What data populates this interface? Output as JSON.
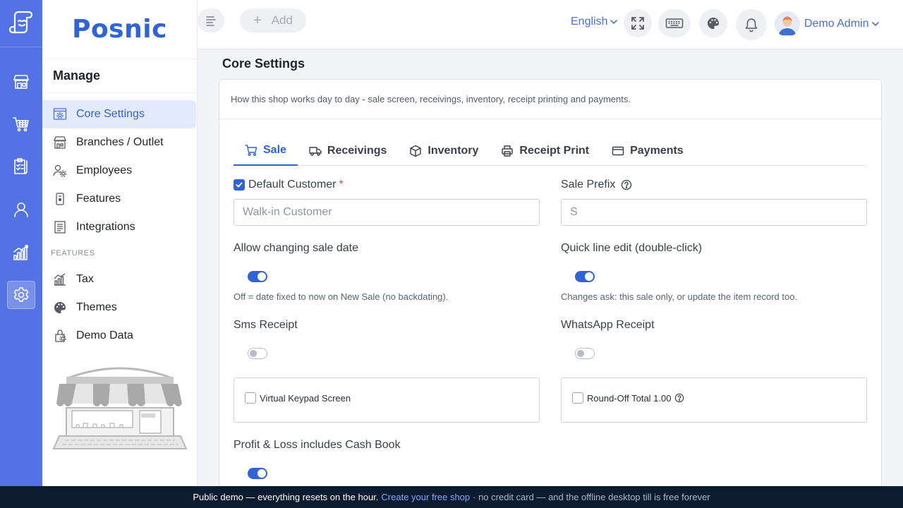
{
  "colors": {
    "accent": "#2f63d6",
    "rail": "#5272e6",
    "banner": "#0d1b30",
    "link": "#7ea7ff",
    "required": "#e0474c"
  },
  "rail": {
    "items": [
      {
        "icon": "store-icon"
      },
      {
        "icon": "cart-icon"
      },
      {
        "icon": "clipboard-icon"
      },
      {
        "icon": "user-icon"
      },
      {
        "icon": "chart-icon"
      },
      {
        "icon": "gear-icon",
        "active": true
      }
    ]
  },
  "sidebar": {
    "brand": "Posnic",
    "title": "Manage",
    "items": [
      {
        "label": "Core Settings",
        "icon": "settings-window-icon"
      },
      {
        "label": "Branches / Outlet",
        "icon": "building-icon"
      },
      {
        "label": "Employees",
        "icon": "employees-icon"
      },
      {
        "label": "Features",
        "icon": "features-icon"
      },
      {
        "label": "Integrations",
        "icon": "integrations-icon"
      }
    ],
    "section_label": "FEATURES",
    "feature_items": [
      {
        "label": "Tax",
        "icon": "tax-icon"
      },
      {
        "label": "Themes",
        "icon": "palette-icon"
      },
      {
        "label": "Demo Data",
        "icon": "demo-data-icon"
      }
    ]
  },
  "topbar": {
    "add_label": "Add",
    "language": "English",
    "user_name": "Demo Admin"
  },
  "page": {
    "title": "Core Settings",
    "description": "How this shop works day to day - sale screen, receivings, inventory, receipt printing and payments."
  },
  "tabs": [
    {
      "label": "Sale",
      "icon": "cart-icon",
      "active": true
    },
    {
      "label": "Receivings",
      "icon": "truck-icon"
    },
    {
      "label": "Inventory",
      "icon": "box-icon"
    },
    {
      "label": "Receipt Print",
      "icon": "printer-icon"
    },
    {
      "label": "Payments",
      "icon": "card-icon"
    }
  ],
  "sale": {
    "default_customer": {
      "label": "Default Customer",
      "required_mark": "*",
      "checked": true,
      "placeholder": "Walk-in Customer"
    },
    "sale_prefix": {
      "label": "Sale Prefix",
      "value": "S"
    },
    "allow_changing_sale_date": {
      "label": "Allow changing sale date",
      "on": true,
      "hint": "Off = date fixed to now on New Sale (no backdating)."
    },
    "quick_line_edit": {
      "label": "Quick line edit (double-click)",
      "on": true,
      "hint": "Changes ask: this sale only, or update the item record too."
    },
    "sms_receipt": {
      "label": "Sms Receipt",
      "on": false
    },
    "whatsapp_receipt": {
      "label": "WhatsApp Receipt",
      "on": false
    },
    "virtual_keypad": {
      "label": "Virtual Keypad Screen",
      "checked": false
    },
    "round_off_total": {
      "label": "Round-Off Total 1.00",
      "checked": false
    },
    "profit_loss_cash_book": {
      "label": "Profit & Loss includes Cash Book",
      "on": true
    }
  },
  "banner": {
    "text": "Public demo — everything resets on the hour.",
    "link": "Create your free shop",
    "rest": "· no credit card — and the offline desktop till is free forever"
  }
}
